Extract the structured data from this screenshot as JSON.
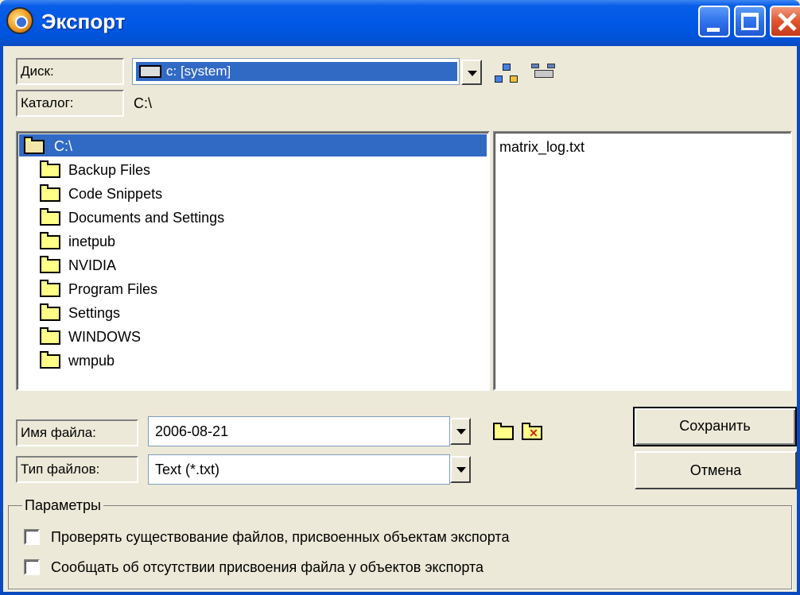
{
  "window": {
    "title": "Экспорт"
  },
  "drive": {
    "label": "Диск:",
    "value": "c: [system]"
  },
  "catalog": {
    "label": "Каталог:",
    "value": "C:\\"
  },
  "folders": {
    "root": "C:\\",
    "items": [
      "Backup Files",
      "Code Snippets",
      "Documents and Settings",
      "inetpub",
      "NVIDIA",
      "Program Files",
      "Settings",
      "WINDOWS",
      "wmpub"
    ]
  },
  "files": [
    "matrix_log.txt"
  ],
  "filename": {
    "label": "Имя файла:",
    "value": "2006-08-21"
  },
  "filetype": {
    "label": "Тип файлов:",
    "value": "Text (*.txt)"
  },
  "buttons": {
    "save": "Сохранить",
    "cancel": "Отмена"
  },
  "params": {
    "title": "Параметры",
    "check_existence": "Проверять существование файлов, присвоенных объектам экспорта",
    "report_missing": "Сообщать об отсутствии присвоения файла у объектов экспорта"
  },
  "colors": {
    "titlebar": "#0058e6",
    "selection": "#316ac5",
    "face": "#ece9d8"
  }
}
